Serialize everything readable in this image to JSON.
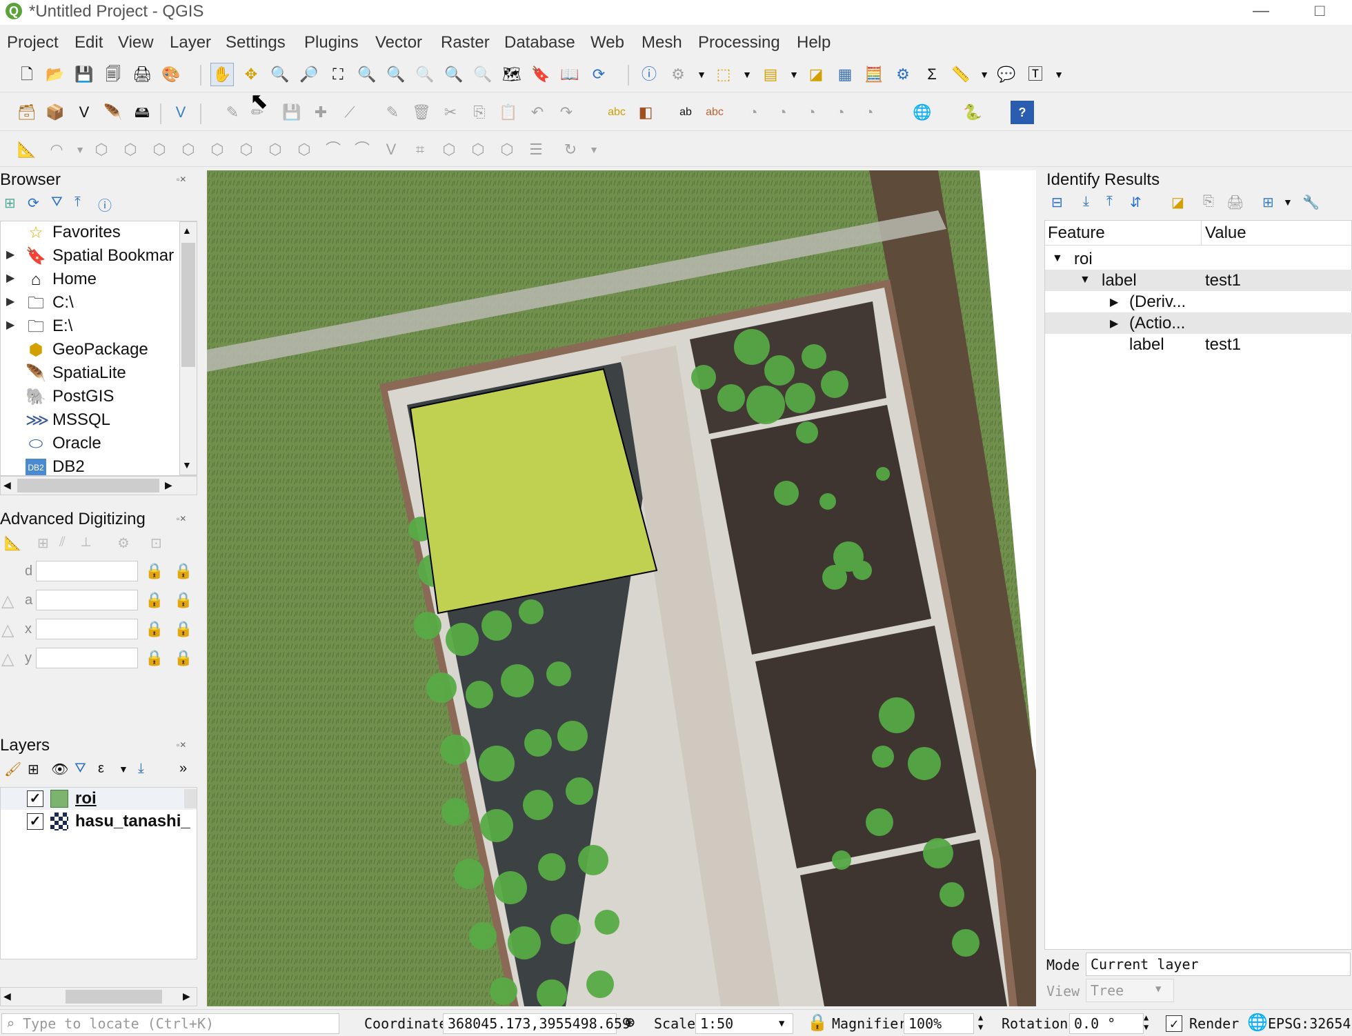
{
  "window": {
    "title": "*Untitled Project - QGIS",
    "minimize": "—",
    "maximize": "□"
  },
  "menu": [
    "Project",
    "Edit",
    "View",
    "Layer",
    "Settings",
    "Plugins",
    "Vector",
    "Raster",
    "Database",
    "Web",
    "Mesh",
    "Processing",
    "Help"
  ],
  "browser": {
    "title": "Browser",
    "items": [
      {
        "label": "Favorites",
        "icon": "star-icon",
        "expandable": false
      },
      {
        "label": "Spatial Bookmar",
        "icon": "bookmark-icon",
        "expandable": true
      },
      {
        "label": "Home",
        "icon": "home-icon",
        "expandable": true
      },
      {
        "label": "C:\\",
        "icon": "folder-icon",
        "expandable": true
      },
      {
        "label": "E:\\",
        "icon": "folder-icon",
        "expandable": true
      },
      {
        "label": "GeoPackage",
        "icon": "geopackage-icon",
        "expandable": false
      },
      {
        "label": "SpatiaLite",
        "icon": "spatialite-icon",
        "expandable": false
      },
      {
        "label": "PostGIS",
        "icon": "postgis-icon",
        "expandable": false
      },
      {
        "label": "MSSQL",
        "icon": "mssql-icon",
        "expandable": false
      },
      {
        "label": "Oracle",
        "icon": "oracle-icon",
        "expandable": false
      },
      {
        "label": "DB2",
        "icon": "db2-icon",
        "expandable": false
      }
    ]
  },
  "digitizing": {
    "title": "Advanced Digitizing",
    "fields": [
      {
        "label": "d",
        "value": ""
      },
      {
        "label": "a",
        "value": ""
      },
      {
        "label": "x",
        "value": ""
      },
      {
        "label": "y",
        "value": ""
      }
    ]
  },
  "layers": {
    "title": "Layers",
    "items": [
      {
        "name": "roi",
        "checked": true,
        "bold": true,
        "underline": true
      },
      {
        "name": "hasu_tanashi_",
        "checked": true,
        "bold": true,
        "underline": false
      }
    ],
    "more": "»"
  },
  "identify": {
    "title": "Identify Results",
    "columns": [
      "Feature",
      "Value"
    ],
    "rows": [
      {
        "indent": 0,
        "expand": "open",
        "feature": "roi",
        "value": ""
      },
      {
        "indent": 1,
        "expand": "open",
        "feature": "label",
        "value": "test1"
      },
      {
        "indent": 2,
        "expand": "closed",
        "feature": "(Deriv...",
        "value": ""
      },
      {
        "indent": 2,
        "expand": "closed",
        "feature": "(Actio...",
        "value": ""
      },
      {
        "indent": 2,
        "expand": "none",
        "feature": "label",
        "value": "test1"
      }
    ],
    "mode_label": "Mode",
    "mode_value": "Current layer",
    "view_label": "View",
    "view_value": "Tree"
  },
  "status": {
    "locate_placeholder": "Type to locate (Ctrl+K)",
    "coordinate_label": "Coordinate",
    "coordinate_value": "368045.173,3955498.659",
    "scale_label": "Scale",
    "scale_value": "1:50",
    "magnifier_label": "Magnifier",
    "magnifier_value": "100%",
    "rotation_label": "Rotation",
    "rotation_value": "0.0 °",
    "render_label": "Render",
    "render_checked": true,
    "crs": "EPSG:32654"
  },
  "map": {
    "polygon_fill": "#c0d050",
    "polygon_stroke": "#000000",
    "grass": "#6f8c4e"
  }
}
